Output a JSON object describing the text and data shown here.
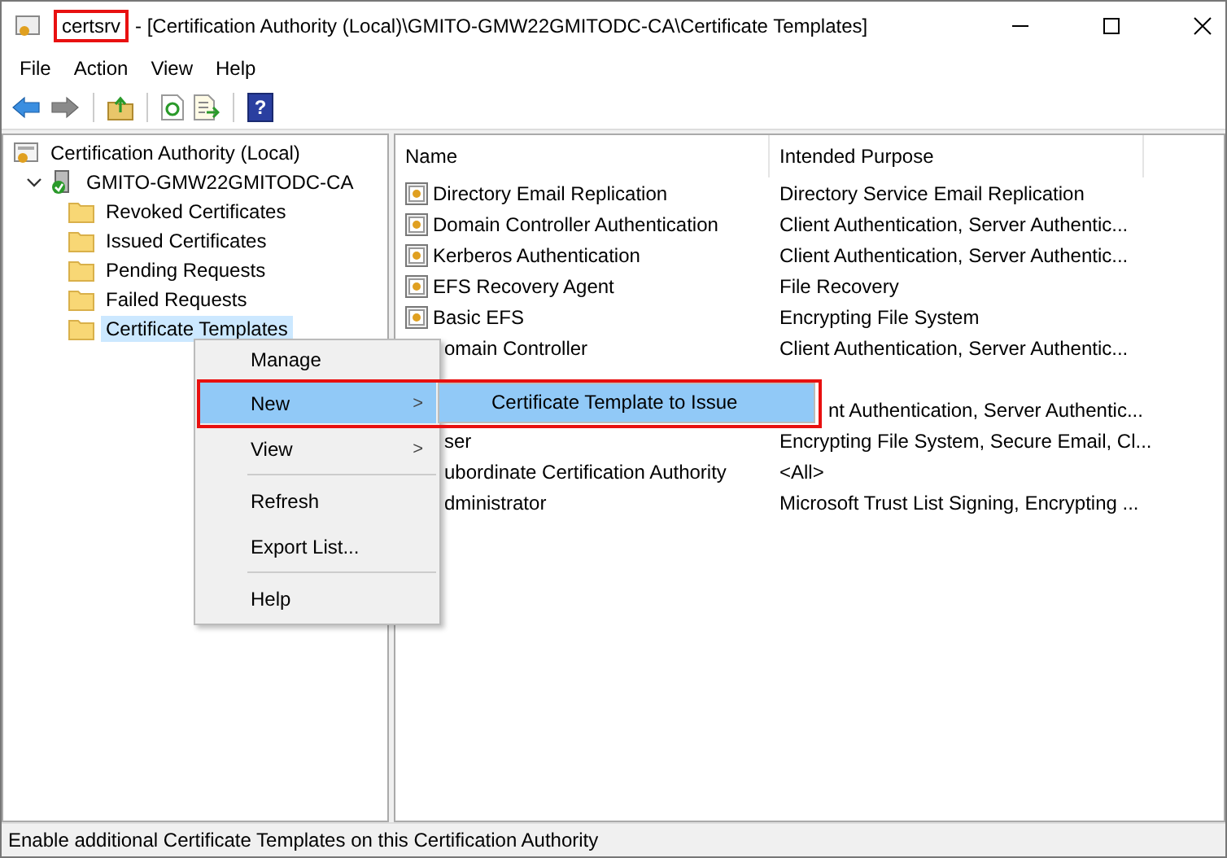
{
  "window": {
    "title_app": "certsrv",
    "title_path": "- [Certification Authority (Local)\\GMITO-GMW22GMITODC-CA\\Certificate Templates]"
  },
  "menu_bar": [
    "File",
    "Action",
    "View",
    "Help"
  ],
  "toolbar": [
    {
      "kind": "back",
      "disabled": false
    },
    {
      "kind": "forward",
      "disabled": true
    },
    {
      "kind": "sep"
    },
    {
      "kind": "up"
    },
    {
      "kind": "sep"
    },
    {
      "kind": "refresh"
    },
    {
      "kind": "export"
    },
    {
      "kind": "sep"
    },
    {
      "kind": "help",
      "glyph": "?"
    }
  ],
  "tree": [
    {
      "label": "Certification Authority (Local)",
      "kind": "root",
      "selected": false,
      "children": [
        {
          "label": "GMITO-GMW22GMITODC-CA",
          "kind": "server",
          "expanded": true,
          "selected": false,
          "children": [
            {
              "label": "Revoked Certificates",
              "kind": "folder",
              "selected": false
            },
            {
              "label": "Issued Certificates",
              "kind": "folder",
              "selected": false
            },
            {
              "label": "Pending Requests",
              "kind": "folder",
              "selected": false
            },
            {
              "label": "Failed Requests",
              "kind": "folder",
              "selected": false
            },
            {
              "label": "Certificate Templates",
              "kind": "folder",
              "selected": true
            }
          ]
        }
      ]
    }
  ],
  "table": {
    "columns": [
      "Name",
      "Intended Purpose"
    ],
    "rows": [
      {
        "kind": "full",
        "name": "Directory Email Replication",
        "purpose": "Directory Service Email Replication"
      },
      {
        "kind": "full",
        "name": "Domain Controller Authentication",
        "purpose": "Client Authentication, Server Authentic..."
      },
      {
        "kind": "full",
        "name": "Kerberos Authentication",
        "purpose": "Client Authentication, Server Authentic..."
      },
      {
        "kind": "full",
        "name": "EFS Recovery Agent",
        "purpose": "File Recovery"
      },
      {
        "kind": "full",
        "name": "Basic EFS",
        "purpose": "Encrypting File System"
      },
      {
        "kind": "cut",
        "name": "omain Controller",
        "purpose": "Client Authentication, Server Authentic..."
      },
      {
        "kind": "covered"
      },
      {
        "kind": "hidden",
        "purpose": "nt Authentication, Server Authentic..."
      },
      {
        "kind": "cut",
        "name": "ser",
        "purpose": "Encrypting File System, Secure Email, Cl..."
      },
      {
        "kind": "cut",
        "name": "ubordinate Certification Authority",
        "purpose": "<All>"
      },
      {
        "kind": "cut",
        "name": "dministrator",
        "purpose": "Microsoft Trust List Signing, Encrypting ..."
      }
    ]
  },
  "context_menu": {
    "items": [
      {
        "kind": "item",
        "label": "Manage",
        "selected": false
      },
      {
        "kind": "submenu",
        "label": "New",
        "selected": true,
        "arrow": ">"
      },
      {
        "kind": "submenu",
        "label": "View",
        "selected": false,
        "arrow": ">"
      },
      {
        "kind": "sep"
      },
      {
        "kind": "item",
        "label": "Refresh",
        "selected": false
      },
      {
        "kind": "item",
        "label": "Export List...",
        "selected": false
      },
      {
        "kind": "sep"
      },
      {
        "kind": "item",
        "label": "Help",
        "selected": false
      }
    ],
    "submenu": [
      {
        "label": "Certificate Template to Issue",
        "selected": true
      }
    ]
  },
  "status_bar": "Enable additional Certificate Templates on this Certification Authority"
}
